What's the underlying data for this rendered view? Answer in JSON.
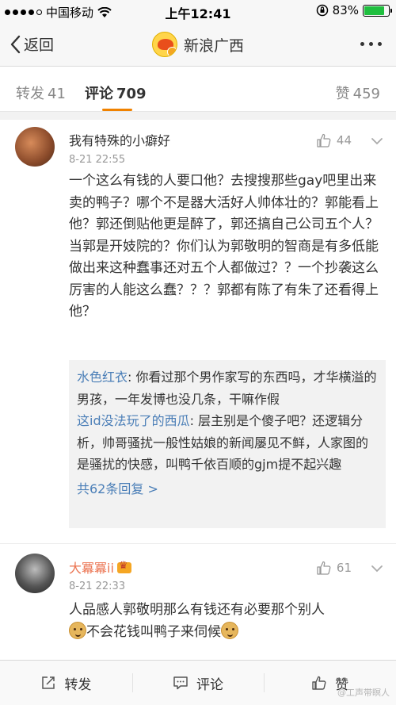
{
  "status_bar": {
    "carrier": "中国移动",
    "time": "上午12:41",
    "battery": "83%",
    "battery_level": 0.83
  },
  "nav": {
    "back_label": "返回",
    "title": "新浪广西",
    "more_icon": "more-dots-icon"
  },
  "tabs": {
    "repost": {
      "label": "转发",
      "count": "41"
    },
    "comments": {
      "label": "评论",
      "count": "709"
    },
    "likes": {
      "label": "赞",
      "count": "459"
    }
  },
  "comments": [
    {
      "user": "我有特殊的小癖好",
      "time": "8-21 22:55",
      "likes": "44",
      "text": "一个这么有钱的人要口他？去搜搜那些gay吧里出来卖的鸭子？哪个不是器大活好人帅体壮的？郭能看上他？郭还倒贴他更是醉了，郭还搞自己公司五个人？当郭是开妓院的？你们认为郭敬明的智商是有多低能做出来这种蠢事还对五个人都做过？？一个抄袭这么厉害的人能这么蠢？？？郭都有陈了有朱了还看得上他？",
      "replies": [
        {
          "name": "水色红衣",
          "sep": ": ",
          "text": "你看过那个男作家写的东西吗，才华横溢的男孩，一年发博也没几条，干嘛作假"
        },
        {
          "name": "这id没法玩了的西瓜",
          "sep": ": ",
          "text": "层主别是个傻子吧？还逻辑分析，帅哥骚扰一般性姑娘的新闻屡见不鲜，人家图的是骚扰的快感，叫鸭千依百顺的gjm提不起兴趣"
        }
      ],
      "more_replies": "共62条回复 >"
    },
    {
      "user": "大冪冪ii",
      "time": "8-21 22:33",
      "likes": "61",
      "text_a": "人品感人郭敬明那么有钱还有必要那个别人",
      "text_b": "不会花钱叫鸭子来伺候"
    }
  ],
  "toolbar": {
    "repost": "转发",
    "comment": "评论",
    "like": "赞"
  },
  "watermark": "@工声带瞑人"
}
